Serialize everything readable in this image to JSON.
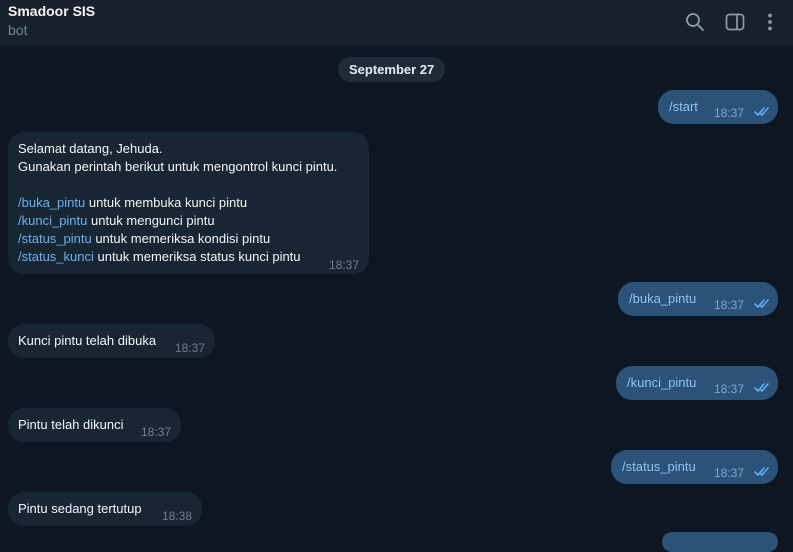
{
  "header": {
    "title": "Smadoor SIS",
    "subtitle": "bot"
  },
  "date_separator": "September 27",
  "messages": {
    "m1": {
      "text": "/start",
      "time": "18:37",
      "direction": "out",
      "status": "read"
    },
    "m2": {
      "direction": "in",
      "time": "18:37",
      "lines": {
        "l1": "Selamat datang, Jehuda.",
        "l2": "Gunakan perintah berikut untuk mengontrol kunci pintu.",
        "l3_cmd": "/buka_pintu",
        "l3_rest": " untuk membuka kunci pintu",
        "l4_cmd": "/kunci_pintu",
        "l4_rest": " untuk mengunci pintu",
        "l5_cmd": "/status_pintu",
        "l5_rest": " untuk memeriksa kondisi pintu",
        "l6_cmd": "/status_kunci",
        "l6_rest": " untuk memeriksa status kunci pintu"
      }
    },
    "m3": {
      "text": "/buka_pintu",
      "time": "18:37",
      "direction": "out",
      "status": "read"
    },
    "m4": {
      "text": "Kunci pintu telah dibuka",
      "time": "18:37",
      "direction": "in"
    },
    "m5": {
      "text": "/kunci_pintu",
      "time": "18:37",
      "direction": "out",
      "status": "read"
    },
    "m6": {
      "text": "Pintu telah dikunci",
      "time": "18:37",
      "direction": "in"
    },
    "m7": {
      "text": "/status_pintu",
      "time": "18:37",
      "direction": "out",
      "status": "read"
    },
    "m8": {
      "text": "Pintu sedang tertutup",
      "time": "18:38",
      "direction": "in"
    }
  },
  "icons": {
    "search": "search-icon",
    "sidebar": "sidebar-toggle-icon",
    "menu": "more-vertical-icon",
    "read": "double-check-icon"
  },
  "colors": {
    "background": "#0e1621",
    "header": "#17212b",
    "incoming_bubble": "#182533",
    "outgoing_bubble": "#2b5278",
    "command_link": "#6ab2f2",
    "read_ticks": "#5fb1f0"
  }
}
